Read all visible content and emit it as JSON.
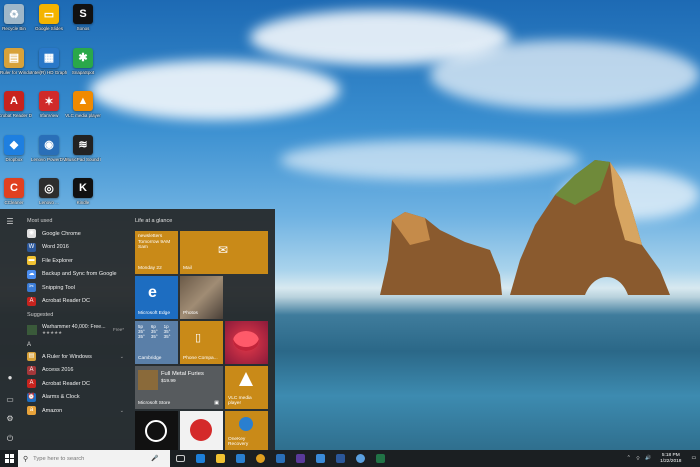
{
  "desktop": {
    "icons": [
      {
        "label": "Recycle Bin",
        "color": "#9fb7c9",
        "glyph": "♻"
      },
      {
        "label": "Google Slides",
        "color": "#f4b400",
        "glyph": "▭"
      },
      {
        "label": "Sonos",
        "color": "#111111",
        "glyph": "S"
      },
      {
        "label": "A Ruler for Windows",
        "color": "#d8a23a",
        "glyph": "▤"
      },
      {
        "label": "Intel(R) HD Graphics Control Panel",
        "color": "#2a78c8",
        "glyph": "▦"
      },
      {
        "label": "SnapaSpot",
        "color": "#2aa84a",
        "glyph": "✱"
      },
      {
        "label": "Acrobat Reader DC",
        "color": "#c8231e",
        "glyph": "A"
      },
      {
        "label": "IrfanView",
        "color": "#d02a2a",
        "glyph": "✶"
      },
      {
        "label": "VLC media player",
        "color": "#f08a00",
        "glyph": "▲"
      },
      {
        "label": "Dropbox",
        "color": "#1e7fe0",
        "glyph": "◆"
      },
      {
        "label": "Lenovo PowerDVD",
        "color": "#2a6fb8",
        "glyph": "◉"
      },
      {
        "label": "MusicPad Sound Recorder",
        "color": "#222222",
        "glyph": "≋"
      },
      {
        "label": "CCleaner",
        "color": "#e04020",
        "glyph": "C"
      },
      {
        "label": "Lenovo ...",
        "color": "#2d2d2d",
        "glyph": "◎"
      },
      {
        "label": "Kindle",
        "color": "#111111",
        "glyph": "K"
      }
    ]
  },
  "start_menu": {
    "most_used_label": "Most used",
    "most_used": [
      {
        "label": "Google Chrome",
        "color": "#e0e0e0",
        "glyph": "◉"
      },
      {
        "label": "Word 2016",
        "color": "#2b579a",
        "glyph": "W"
      },
      {
        "label": "File Explorer",
        "color": "#f1c232",
        "glyph": "▬"
      },
      {
        "label": "Backup and Sync from Google",
        "color": "#4a8df0",
        "glyph": "☁"
      },
      {
        "label": "Snipping Tool",
        "color": "#3a7bd5",
        "glyph": "✂"
      },
      {
        "label": "Acrobat Reader DC",
        "color": "#c8231e",
        "glyph": "A"
      }
    ],
    "suggested_label": "Suggested",
    "suggested": {
      "title": "Warhammer 40,000: Free...",
      "badge": "Free*",
      "stars": "★★★★★"
    },
    "letter": "A",
    "a_apps": [
      {
        "label": "A Ruler for Windows",
        "color": "#d8a23a",
        "glyph": "▤",
        "expand": true
      },
      {
        "label": "Access 2016",
        "color": "#a4373a",
        "glyph": "A",
        "expand": false
      },
      {
        "label": "Acrobat Reader DC",
        "color": "#c8231e",
        "glyph": "A",
        "expand": false
      },
      {
        "label": "Alarms & Clock",
        "color": "#1d6dc1",
        "glyph": "⏰",
        "expand": false
      },
      {
        "label": "Amazon",
        "color": "#e8a33a",
        "glyph": "a",
        "expand": true
      }
    ],
    "tiles_header": "Life at a glance",
    "tiles": {
      "calendar": {
        "event1": "newsletters",
        "event2": "Tomorrow 9AM",
        "event3": "Sam",
        "date": "Monday 22"
      },
      "mail": {
        "label": "Mail"
      },
      "edge": {
        "label": "Microsoft Edge"
      },
      "photos": {
        "label": "Photos"
      },
      "weather": {
        "days": [
          "5p",
          "6p",
          "1p"
        ],
        "temps": [
          "35°",
          "35°",
          "35°"
        ],
        "temps2": [
          "35°",
          "35°",
          "35°"
        ],
        "label": "Cambridge"
      },
      "phone": {
        "label": "Phone Compa..."
      },
      "store": {
        "title": "Full Metal Furies",
        "price": "$19.99",
        "label": "Microsoft Store"
      },
      "vlc": {
        "label": "VLC media player"
      },
      "onekey": {
        "label": "OneKey Recovery"
      }
    }
  },
  "taskbar": {
    "search_placeholder": "Type here to search",
    "time": "5:18 PM",
    "date": "1/22/2018"
  }
}
